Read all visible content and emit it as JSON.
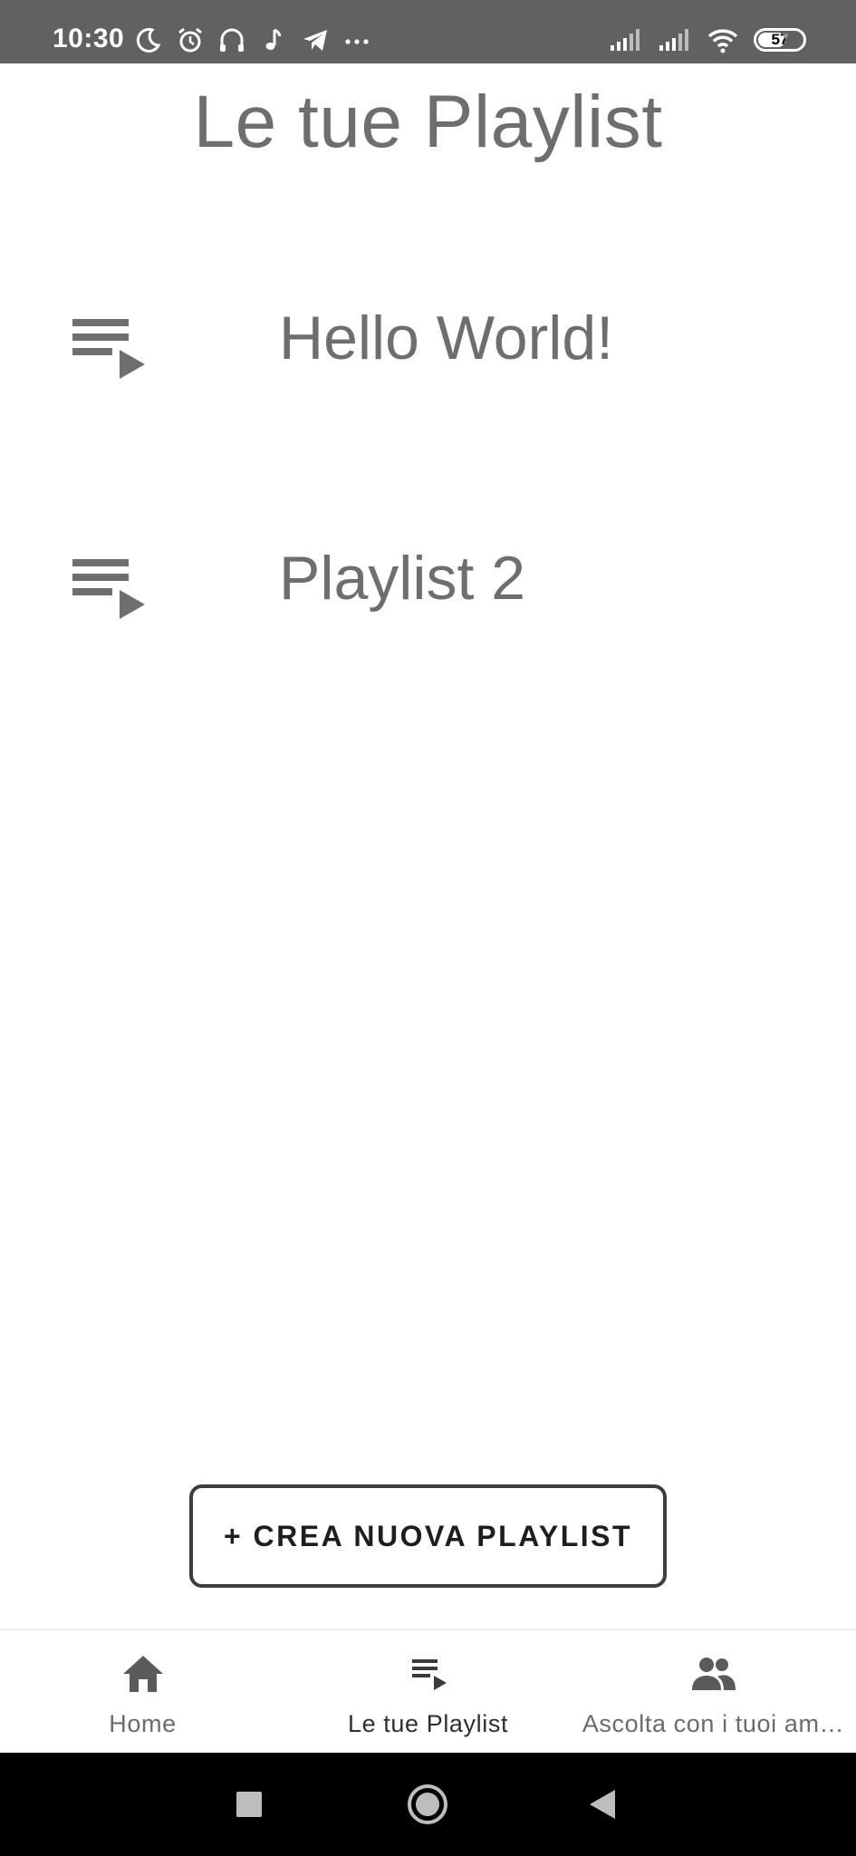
{
  "status_bar": {
    "time": "10:30",
    "battery_level": "57",
    "left_icons": [
      "moon-icon",
      "alarm-icon",
      "headphones-icon",
      "music-note-icon",
      "telegram-icon",
      "more-dots-icon"
    ],
    "right_icons": [
      "signal-icon",
      "signal-icon",
      "wifi-icon",
      "battery-icon"
    ]
  },
  "header": {
    "title": "Le tue Playlist"
  },
  "playlists": [
    {
      "name": "Hello World!",
      "icon": "playlist-play-icon"
    },
    {
      "name": "Playlist 2",
      "icon": "playlist-play-icon"
    }
  ],
  "create_button": {
    "label": "+ CREA NUOVA PLAYLIST"
  },
  "bottom_nav": {
    "items": [
      {
        "label": "Home",
        "icon": "home-icon",
        "active": false
      },
      {
        "label": "Le tue Playlist",
        "icon": "playlist-play-icon",
        "active": true
      },
      {
        "label": "Ascolta con i tuoi am…",
        "icon": "people-icon",
        "active": false
      }
    ]
  },
  "system_nav": {
    "buttons": [
      "recents-square-icon",
      "home-circle-icon",
      "back-triangle-icon"
    ]
  },
  "colors": {
    "status_bar_bg": "#616161",
    "text_gray": "#6e6e6e",
    "button_border": "#3d3d3d",
    "system_nav_bg": "#000000"
  }
}
